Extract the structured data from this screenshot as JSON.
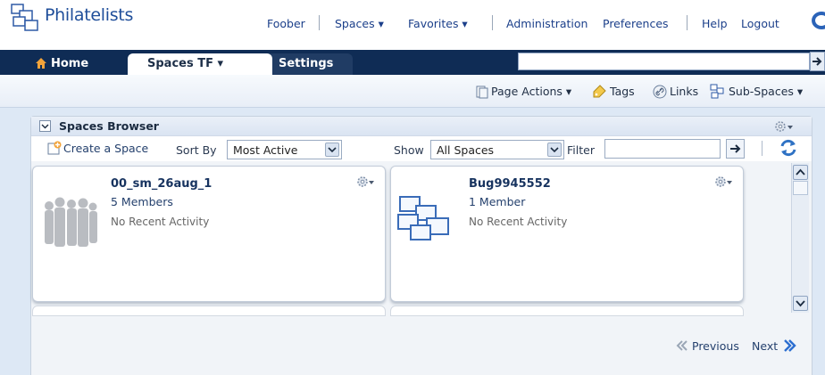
{
  "header": {
    "brand": "Philatelists",
    "nav": [
      {
        "label": "Foober"
      },
      {
        "label": "Spaces ▾"
      },
      {
        "label": "Favorites ▾"
      },
      {
        "label": "Administration"
      },
      {
        "label": "Preferences"
      },
      {
        "label": "Help"
      },
      {
        "label": "Logout"
      }
    ]
  },
  "tabs": {
    "home": "Home",
    "spaces": "Spaces TF  ▾",
    "settings": "Settings"
  },
  "actions": {
    "page_actions": "Page Actions ▾",
    "tags": "Tags",
    "links": "Links",
    "sub_spaces": "Sub-Spaces ▾"
  },
  "panel": {
    "title": "Spaces Browser",
    "create": "Create a Space",
    "sort_by_label": "Sort By",
    "sort_by_value": "Most Active",
    "show_label": "Show",
    "show_value": "All Spaces",
    "filter_label": "Filter",
    "filter_value": ""
  },
  "spaces": [
    {
      "name": "00_sm_26aug_1",
      "members": "5 Members",
      "activity": "No Recent Activity"
    },
    {
      "name": "Bug9945552",
      "members": "1 Member",
      "activity": "No Recent Activity"
    }
  ],
  "pager": {
    "previous": "Previous",
    "next": "Next"
  },
  "colors": {
    "brand_blue": "#1f4e9a",
    "tab_band": "#0f2c55",
    "panel_bg": "#dde8f5"
  }
}
